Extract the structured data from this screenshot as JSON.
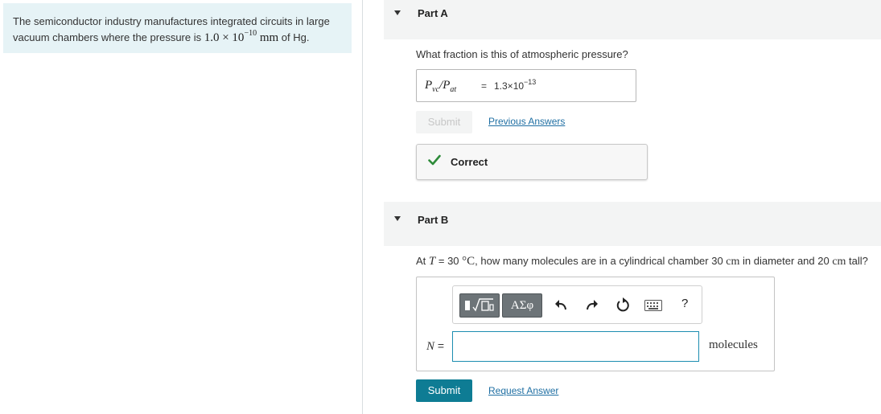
{
  "problem": {
    "text_before": "The semiconductor industry manufactures integrated circuits in large vacuum chambers where the pressure is ",
    "pressure_mantissa": "1.0 × 10",
    "pressure_exp": "−10",
    "pressure_unit": " mm",
    "text_after": " of Hg."
  },
  "part_a": {
    "title": "Part A",
    "question": "What fraction is this of atmospheric pressure?",
    "answer": {
      "lhs_p1": "P",
      "lhs_sub1": "vc",
      "lhs_slash": "/",
      "lhs_p2": "P",
      "lhs_sub2": "at",
      "equals": "=",
      "value_mantissa": "1.3×10",
      "value_exp": "−13"
    },
    "submit_label": "Submit",
    "previous_answers_label": "Previous Answers",
    "feedback_label": "Correct"
  },
  "part_b": {
    "title": "Part B",
    "question": {
      "at": "At ",
      "T": "T",
      "eq_temp": " = 30 ",
      "temp_unit": "°C",
      "mid": ", how many molecules are in a cylindrical chamber 30 ",
      "cm1": "cm",
      "mid2": " in diameter and 20 ",
      "cm2": "cm",
      "end": " tall?"
    },
    "toolbar": {
      "templates_label": "",
      "greek_label": "ΑΣφ",
      "help_label": "?"
    },
    "input_label_var": "N",
    "input_label_eq": " =",
    "input_value": "",
    "unit": "molecules",
    "submit_label": "Submit",
    "request_answer_label": "Request Answer"
  },
  "colors": {
    "problem_bg": "#e6f3f6",
    "part_header_bg": "#f3f4f4",
    "primary_button": "#0e7c94",
    "link": "#1f6fa3",
    "correct_check": "#2e8b3a",
    "input_border": "#1c8db0"
  }
}
